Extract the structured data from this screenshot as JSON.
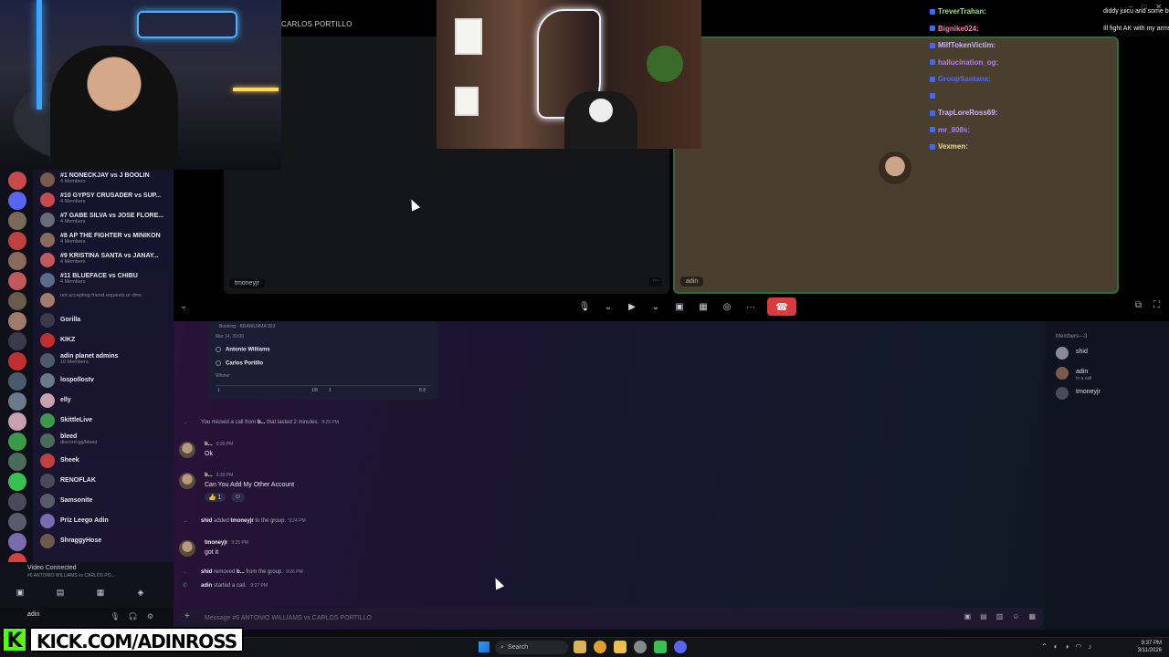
{
  "call": {
    "top_name": "CARLOS PORTILLO",
    "left_tile_label": "tmoneyjr",
    "right_tile_label": "adin",
    "end_icon": "phone-hangup-icon"
  },
  "stream_chat": [
    {
      "name": "TreverTrahan:",
      "msg": "diddy juicu and some bye sexys for ak",
      "color": "#9be37a"
    },
    {
      "name": "Bignike024:",
      "msg": "Ill fight AK with my arms taped behind my back",
      "color": "#ff7ab0"
    },
    {
      "name": "MilfTokenVictim:",
      "msg": "",
      "color": "#c9b3ff"
    },
    {
      "name": "hallucination_og:",
      "msg": "",
      "color": "#b07aff"
    },
    {
      "name": "GroupSantana:",
      "msg": "",
      "color": "#4b6bff"
    },
    {
      "name": "",
      "msg": "",
      "color": "#d83c3e"
    },
    {
      "name": "TrapLoreRoss69:",
      "msg": "",
      "color": "#c9b3ff"
    },
    {
      "name": "mr_808s:",
      "msg": "",
      "color": "#b07aff"
    },
    {
      "name": "Vexmen:",
      "msg": "",
      "color": "#f2d9a0"
    }
  ],
  "channels": [
    {
      "title": "#1 NONECKJAY vs J BOOLIN",
      "sub": "4 Members",
      "color": "#7a5a4a"
    },
    {
      "title": "#10 GYPSY CRUSADER vs SUP...",
      "sub": "4 Members",
      "color": "#c84a4a"
    },
    {
      "title": "#7 GABE SILVA vs JOSE FLORE...",
      "sub": "4 Members",
      "color": "#6a6a7a"
    },
    {
      "title": "#8 AP THE FIGHTER vs MINIKON",
      "sub": "4 Members",
      "color": "#8a6a5a"
    },
    {
      "title": "#9 KRISTINA SANTA vs JANAY...",
      "sub": "4 Members",
      "color": "#c05a5a"
    },
    {
      "title": "#11 BLUEFACE vs CHIBU",
      "sub": "4 Members",
      "color": "#5a6a8a"
    },
    {
      "title": "",
      "sub": "not accepting friend requests or dms",
      "color": "#a07a6a"
    },
    {
      "title": "Gorilla",
      "sub": "",
      "color": "#3a3a4a"
    },
    {
      "title": "KIKZ",
      "sub": "",
      "color": "#c03030"
    },
    {
      "title": "adin planet admins",
      "sub": "10 Members",
      "color": "#4a5a6a"
    },
    {
      "title": "lospollostv",
      "sub": "",
      "color": "#6a7a8a"
    },
    {
      "title": "elly",
      "sub": "",
      "color": "#c8a0b0"
    },
    {
      "title": "SkittleLive",
      "sub": "",
      "color": "#3a9a4a"
    },
    {
      "title": "bleed",
      "sub": "discord.gg/bleed",
      "color": "#4a6a5a"
    },
    {
      "title": "Sheek",
      "sub": "",
      "color": "#c04040"
    },
    {
      "title": "RENOFLAK",
      "sub": "",
      "color": "#4a4a5a"
    },
    {
      "title": "Samsonite",
      "sub": "",
      "color": "#5a5a6a"
    },
    {
      "title": "Priz Leego Adin",
      "sub": "",
      "color": "#7a6ab0"
    },
    {
      "title": "ShraggyHose",
      "sub": "",
      "color": "#6a5a4a"
    }
  ],
  "voice": {
    "title": "Video Connected",
    "sub": "#6 ANTONIO WILLIAMS vs CARLOS PO..."
  },
  "user_panel": {
    "name": "adin"
  },
  "embed": {
    "header": "Booking · BRAWLMMA 303",
    "date": "Mar 14, 20:00",
    "options": [
      "Antonio Williams",
      "Carlos Portillo"
    ],
    "winner": "Winner",
    "bar_vals": [
      "1",
      "1/8",
      "1",
      "8.8"
    ]
  },
  "messages": [
    {
      "kind": "sys",
      "text": "You missed a call from",
      "bold": "b...",
      "rest": "that lasted 2 minutes.",
      "time": "9:29 PM"
    },
    {
      "kind": "msg",
      "author": "b...",
      "time": "9:30 PM",
      "body": "Ok"
    },
    {
      "kind": "msg",
      "author": "b...",
      "time": "9:30 PM",
      "body": "Can You Add My Other Account"
    },
    {
      "kind": "sys",
      "bold": "shid",
      "text": "added",
      "bold2": "tmoneyjr",
      "rest": "to the group.",
      "time": "9:24 PM"
    },
    {
      "kind": "msg",
      "author": "tmoneyjr",
      "time": "9:25 PM",
      "body": "got it"
    },
    {
      "kind": "sys",
      "bold": "shid",
      "text": "removed",
      "bold2": "b...",
      "rest": "from the group.",
      "time": "9:26 PM"
    },
    {
      "kind": "sys",
      "bold": "adin",
      "text": "started a call.",
      "bold2": "",
      "rest": "",
      "time": "9:27 PM"
    }
  ],
  "reactions": [
    "👍 1",
    "☺"
  ],
  "composer": {
    "placeholder": "Message #6 ANTONIO WILLIAMS vs CARLOS PORTILLO"
  },
  "members": {
    "header": "Members—3",
    "list": [
      {
        "name": "shid",
        "status": "",
        "color": "#8a8a9a"
      },
      {
        "name": "adin",
        "status": "In a call",
        "color": "#7a5a4a"
      },
      {
        "name": "tmoneyjr",
        "status": "",
        "color": "#4a4a5a"
      }
    ]
  },
  "taskbar": {
    "search_label": "Search",
    "clock_time": "9:37 PM",
    "clock_date": "3/11/2026"
  },
  "kick": {
    "logo": "K",
    "url": "KICK.COM/ADINROSS"
  }
}
